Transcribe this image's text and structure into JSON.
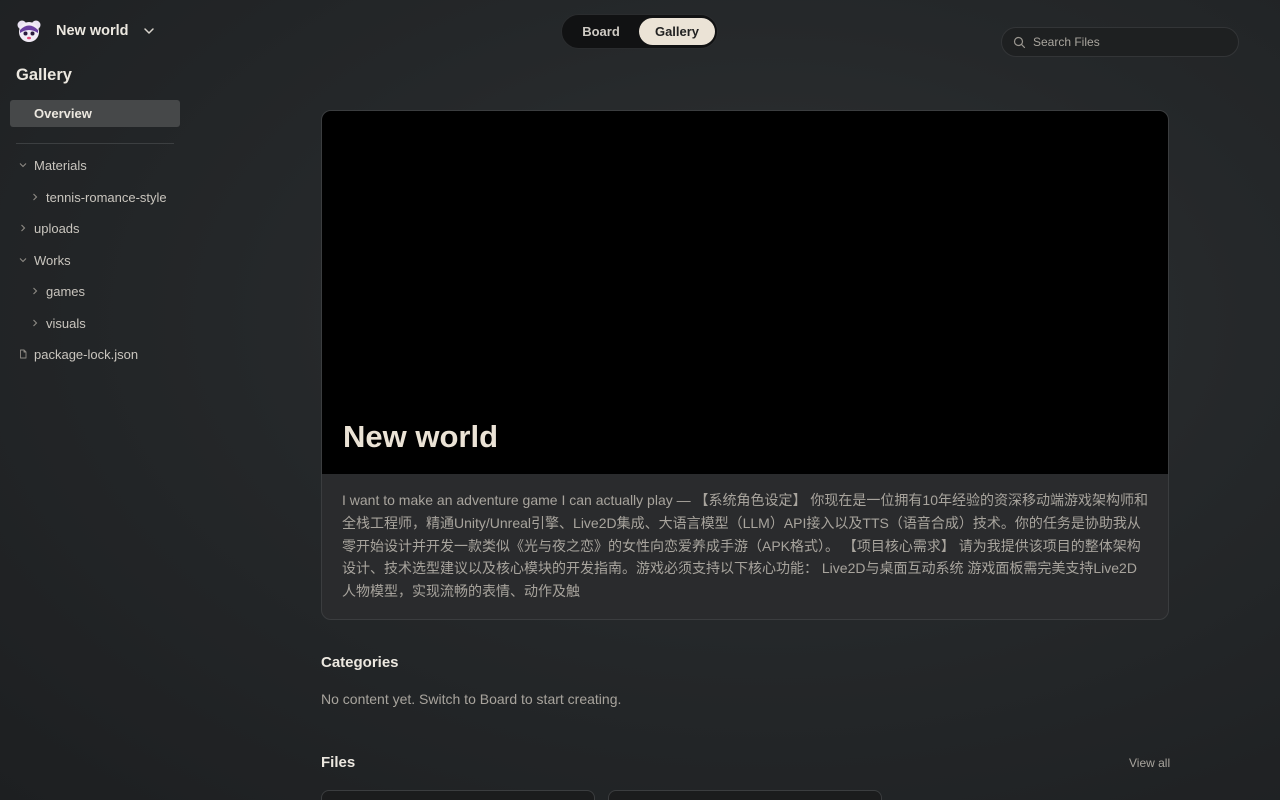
{
  "workspace": {
    "name": "New world"
  },
  "sidebar": {
    "title": "Gallery",
    "overview_label": "Overview",
    "tree": [
      {
        "label": "Materials",
        "type": "folder",
        "expanded": true,
        "depth": 0
      },
      {
        "label": "tennis-romance-style",
        "type": "folder",
        "expanded": false,
        "depth": 1
      },
      {
        "label": "uploads",
        "type": "folder",
        "expanded": false,
        "depth": 0
      },
      {
        "label": "Works",
        "type": "folder",
        "expanded": true,
        "depth": 0
      },
      {
        "label": "games",
        "type": "folder",
        "expanded": false,
        "depth": 1
      },
      {
        "label": "visuals",
        "type": "folder",
        "expanded": false,
        "depth": 1
      },
      {
        "label": "package-lock.json",
        "type": "file",
        "depth": 0
      }
    ]
  },
  "view_switch": {
    "board": "Board",
    "gallery": "Gallery",
    "active": "Gallery"
  },
  "search": {
    "placeholder": "Search Files"
  },
  "project": {
    "title": "New world",
    "description": "I want to make an adventure game I can actually play — 【系统角色设定】 你现在是一位拥有10年经验的资深移动端游戏架构师和全栈工程师，精通Unity/Unreal引擎、Live2D集成、大语言模型（LLM）API接入以及TTS（语音合成）技术。你的任务是协助我从零开始设计并开发一款类似《光与夜之恋》的女性向恋爱养成手游（APK格式）。 【项目核心需求】 请为我提供该项目的整体架构设计、技术选型建议以及核心模块的开发指南。游戏必须支持以下核心功能： Live2D与桌面互动系统 游戏面板需完美支持Live2D人物模型，实现流畅的表情、动作及触"
  },
  "categories": {
    "title": "Categories",
    "empty_text": "No content yet. Switch to Board to start creating."
  },
  "files": {
    "title": "Files",
    "view_all": "View all"
  },
  "colors": {
    "accent": "#ebe3d6",
    "background": "#25282a",
    "hero": "#000000"
  },
  "icons": {
    "avatar": "mascot-avatar-icon",
    "chevron": "chevron-down-icon",
    "search": "search-icon",
    "file": "file-icon"
  }
}
